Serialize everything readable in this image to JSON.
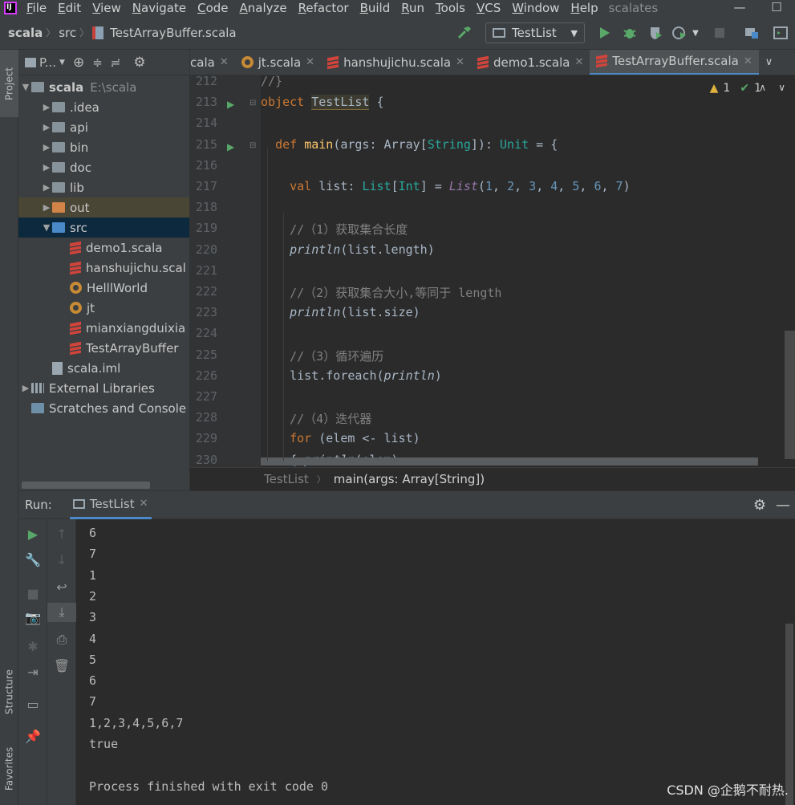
{
  "menubar": {
    "items": [
      "File",
      "Edit",
      "View",
      "Navigate",
      "Code",
      "Analyze",
      "Refactor",
      "Build",
      "Run",
      "Tools",
      "VCS",
      "Window",
      "Help"
    ],
    "window_title": "scalates"
  },
  "breadcrumb": {
    "project": "scala",
    "dir": "src",
    "file": "TestArrayBuffer.scala"
  },
  "runconfig": {
    "label": "TestList"
  },
  "sidebar": {
    "project_tab": "Project",
    "structure_tab": "Structure",
    "favorites_tab": "Favorites",
    "header_label": "P..."
  },
  "tree": [
    {
      "label": "scala",
      "extra": "E:\\scala",
      "level": 0,
      "icon": "folder",
      "open": true
    },
    {
      "label": ".idea",
      "level": 1,
      "icon": "folder"
    },
    {
      "label": "api",
      "level": 1,
      "icon": "folder"
    },
    {
      "label": "bin",
      "level": 1,
      "icon": "folder"
    },
    {
      "label": "doc",
      "level": 1,
      "icon": "folder"
    },
    {
      "label": "lib",
      "level": 1,
      "icon": "folder"
    },
    {
      "label": "out",
      "level": 1,
      "icon": "folder-orange"
    },
    {
      "label": "src",
      "level": 1,
      "icon": "folder-blue",
      "open": true
    },
    {
      "label": "demo1.scala",
      "level": 2,
      "icon": "scala"
    },
    {
      "label": "hanshujichu.scal",
      "level": 2,
      "icon": "scala"
    },
    {
      "label": "HelllWorld",
      "level": 2,
      "icon": "object"
    },
    {
      "label": "jt",
      "level": 2,
      "icon": "object"
    },
    {
      "label": "mianxiangduixia",
      "level": 2,
      "icon": "scala"
    },
    {
      "label": "TestArrayBuffer",
      "level": 2,
      "icon": "scala"
    },
    {
      "label": "scala.iml",
      "level": 1,
      "icon": "doc"
    },
    {
      "label": "External Libraries",
      "level": 0,
      "icon": "lib"
    },
    {
      "label": "Scratches and Console",
      "level": 0,
      "icon": "scratch"
    }
  ],
  "tabs": [
    {
      "label": "cala"
    },
    {
      "label": "jt.scala"
    },
    {
      "label": "hanshujichu.scala"
    },
    {
      "label": "demo1.scala"
    },
    {
      "label": "TestArrayBuffer.scala",
      "active": true
    }
  ],
  "inspections": {
    "warnings": "1",
    "ok": "1"
  },
  "code": {
    "line_numbers": [
      "212",
      "213",
      "214",
      "215",
      "216",
      "217",
      "218",
      "219",
      "220",
      "221",
      "222",
      "223",
      "224",
      "225",
      "226",
      "227",
      "228",
      "229",
      "230"
    ],
    "lines": [
      "//}",
      "object TestList {",
      "",
      "  def main(args: Array[String]): Unit = {",
      "",
      "    val list: List[Int] = List(1, 2, 3, 4, 5, 6, 7)",
      "",
      "    //（1）获取集合长度",
      "    println(list.length)",
      "",
      "    //（2）获取集合大小,等同于 length",
      "    println(list.size)",
      "",
      "    //（3）循环遍历",
      "    list.foreach(println)",
      "",
      "    //（4）迭代器",
      "    for (elem <- list)",
      "    { println(elem)"
    ]
  },
  "editor_breadcrumb": {
    "object": "TestList",
    "method": "main(args: Array[String])"
  },
  "run": {
    "label": "Run:",
    "tab": "TestList"
  },
  "console": [
    "6",
    "7",
    "1",
    "2",
    "3",
    "4",
    "5",
    "6",
    "7",
    "1,2,3,4,5,6,7",
    "true",
    "",
    "Process finished with exit code 0"
  ],
  "watermark": "CSDN @企鹅不耐热."
}
